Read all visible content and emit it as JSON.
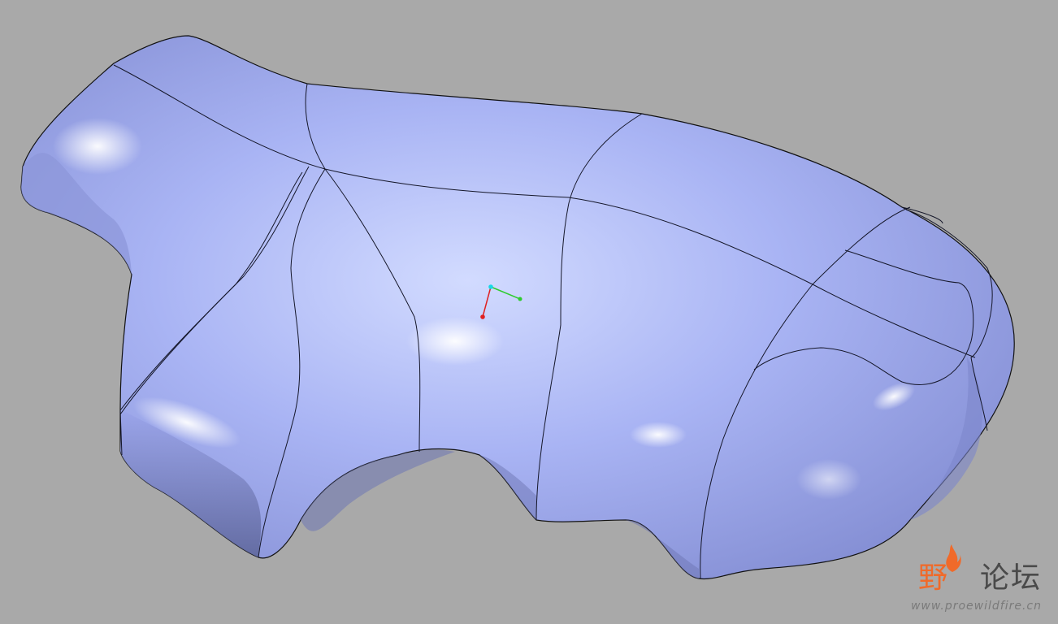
{
  "viewport": {
    "background": "#a9a9a9",
    "model_color": "#a7b2f3",
    "edge_color": "#1a1a2e"
  },
  "csys_axes": {
    "x_color": "#2ecc2e",
    "y_color": "#18d8e8",
    "z_color": "#e02020"
  },
  "watermark": {
    "chinese_part1": "野",
    "chinese_part2": "论坛",
    "url": "www.proewildfire.cn",
    "accent_color": "#f06a2a"
  }
}
